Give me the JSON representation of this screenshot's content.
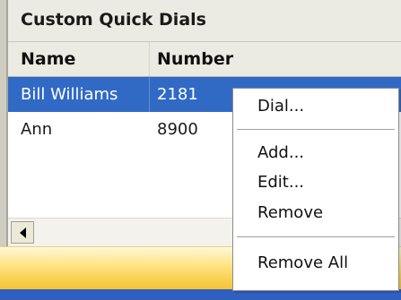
{
  "panel": {
    "title": "Custom Quick Dials"
  },
  "table": {
    "columns": {
      "name": "Name",
      "number": "Number"
    },
    "rows": [
      {
        "name": "Bill Williams",
        "number": "2181",
        "selected": true
      },
      {
        "name": "Ann",
        "number": "8900",
        "selected": false
      }
    ]
  },
  "context_menu": {
    "items": [
      {
        "label": "Dial..."
      },
      {
        "label": "Add..."
      },
      {
        "label": "Edit..."
      },
      {
        "label": "Remove"
      },
      {
        "label": "Remove All"
      }
    ]
  },
  "colors": {
    "selection": "#316ac5",
    "header_bg": "#ecebe3",
    "status_bar": "#f9cf4a",
    "bottom_strip": "#2f5fbf"
  },
  "icons": {
    "scroll_left": "left-arrow-icon"
  }
}
